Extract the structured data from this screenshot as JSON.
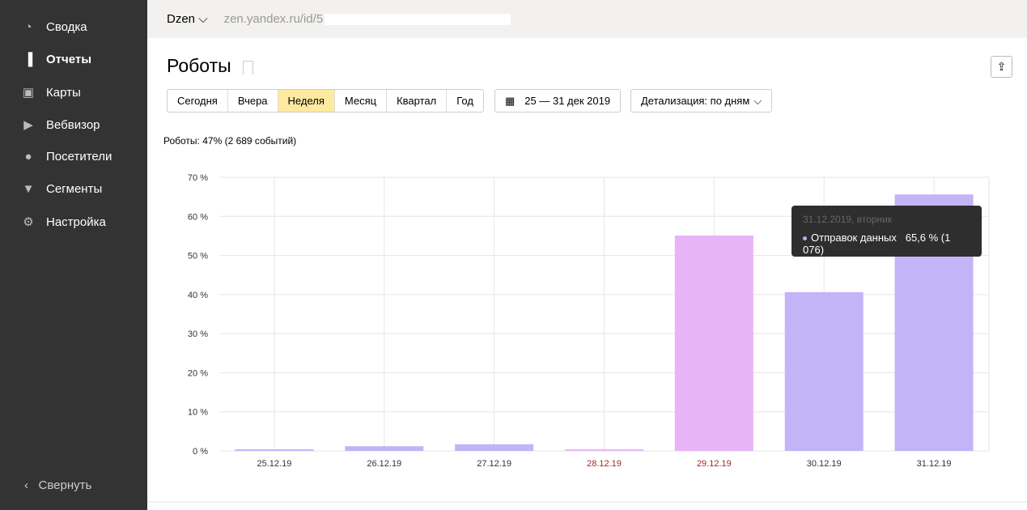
{
  "sidebar": {
    "items": [
      {
        "label": "Сводка",
        "icon": "gauge-icon"
      },
      {
        "label": "Отчеты",
        "icon": "bar-chart-icon"
      },
      {
        "label": "Карты",
        "icon": "map-icon"
      },
      {
        "label": "Вебвизор",
        "icon": "play-icon"
      },
      {
        "label": "Посетители",
        "icon": "user-icon"
      },
      {
        "label": "Сегменты",
        "icon": "filter-icon"
      },
      {
        "label": "Настройка",
        "icon": "gear-icon"
      }
    ],
    "collapse": "Свернуть"
  },
  "topbar": {
    "counter": "Dzen",
    "url": "zen.yandex.ru/id/5"
  },
  "title": "Роботы",
  "periods": [
    "Сегодня",
    "Вчера",
    "Неделя",
    "Месяц",
    "Квартал",
    "Год"
  ],
  "selected_period": "Неделя",
  "date_range": "25 — 31 дек 2019",
  "detail": "Детализация: по дням",
  "summary": "Роботы: 47% (2 689 событий)",
  "tooltip": {
    "date": "31.12.2019, вторник",
    "series": "Отправок данных",
    "value": "65,6 % (1 076)"
  },
  "chart_data": {
    "type": "bar",
    "categories": [
      "25.12.19",
      "26.12.19",
      "27.12.19",
      "28.12.19",
      "29.12.19",
      "30.12.19",
      "31.12.19"
    ],
    "values": [
      0.4,
      1.2,
      1.7,
      0.4,
      55.1,
      40.6,
      65.6
    ],
    "weekend": [
      false,
      false,
      false,
      true,
      true,
      false,
      false
    ],
    "yticks": [
      "0 %",
      "10 %",
      "20 %",
      "30 %",
      "40 %",
      "50 %",
      "60 %",
      "70 %"
    ],
    "ylim": [
      0,
      70
    ],
    "colors": {
      "weekday": "#c3b4f7",
      "weekend": "#e7b4f8",
      "weekend_label": "#a0282d"
    }
  }
}
